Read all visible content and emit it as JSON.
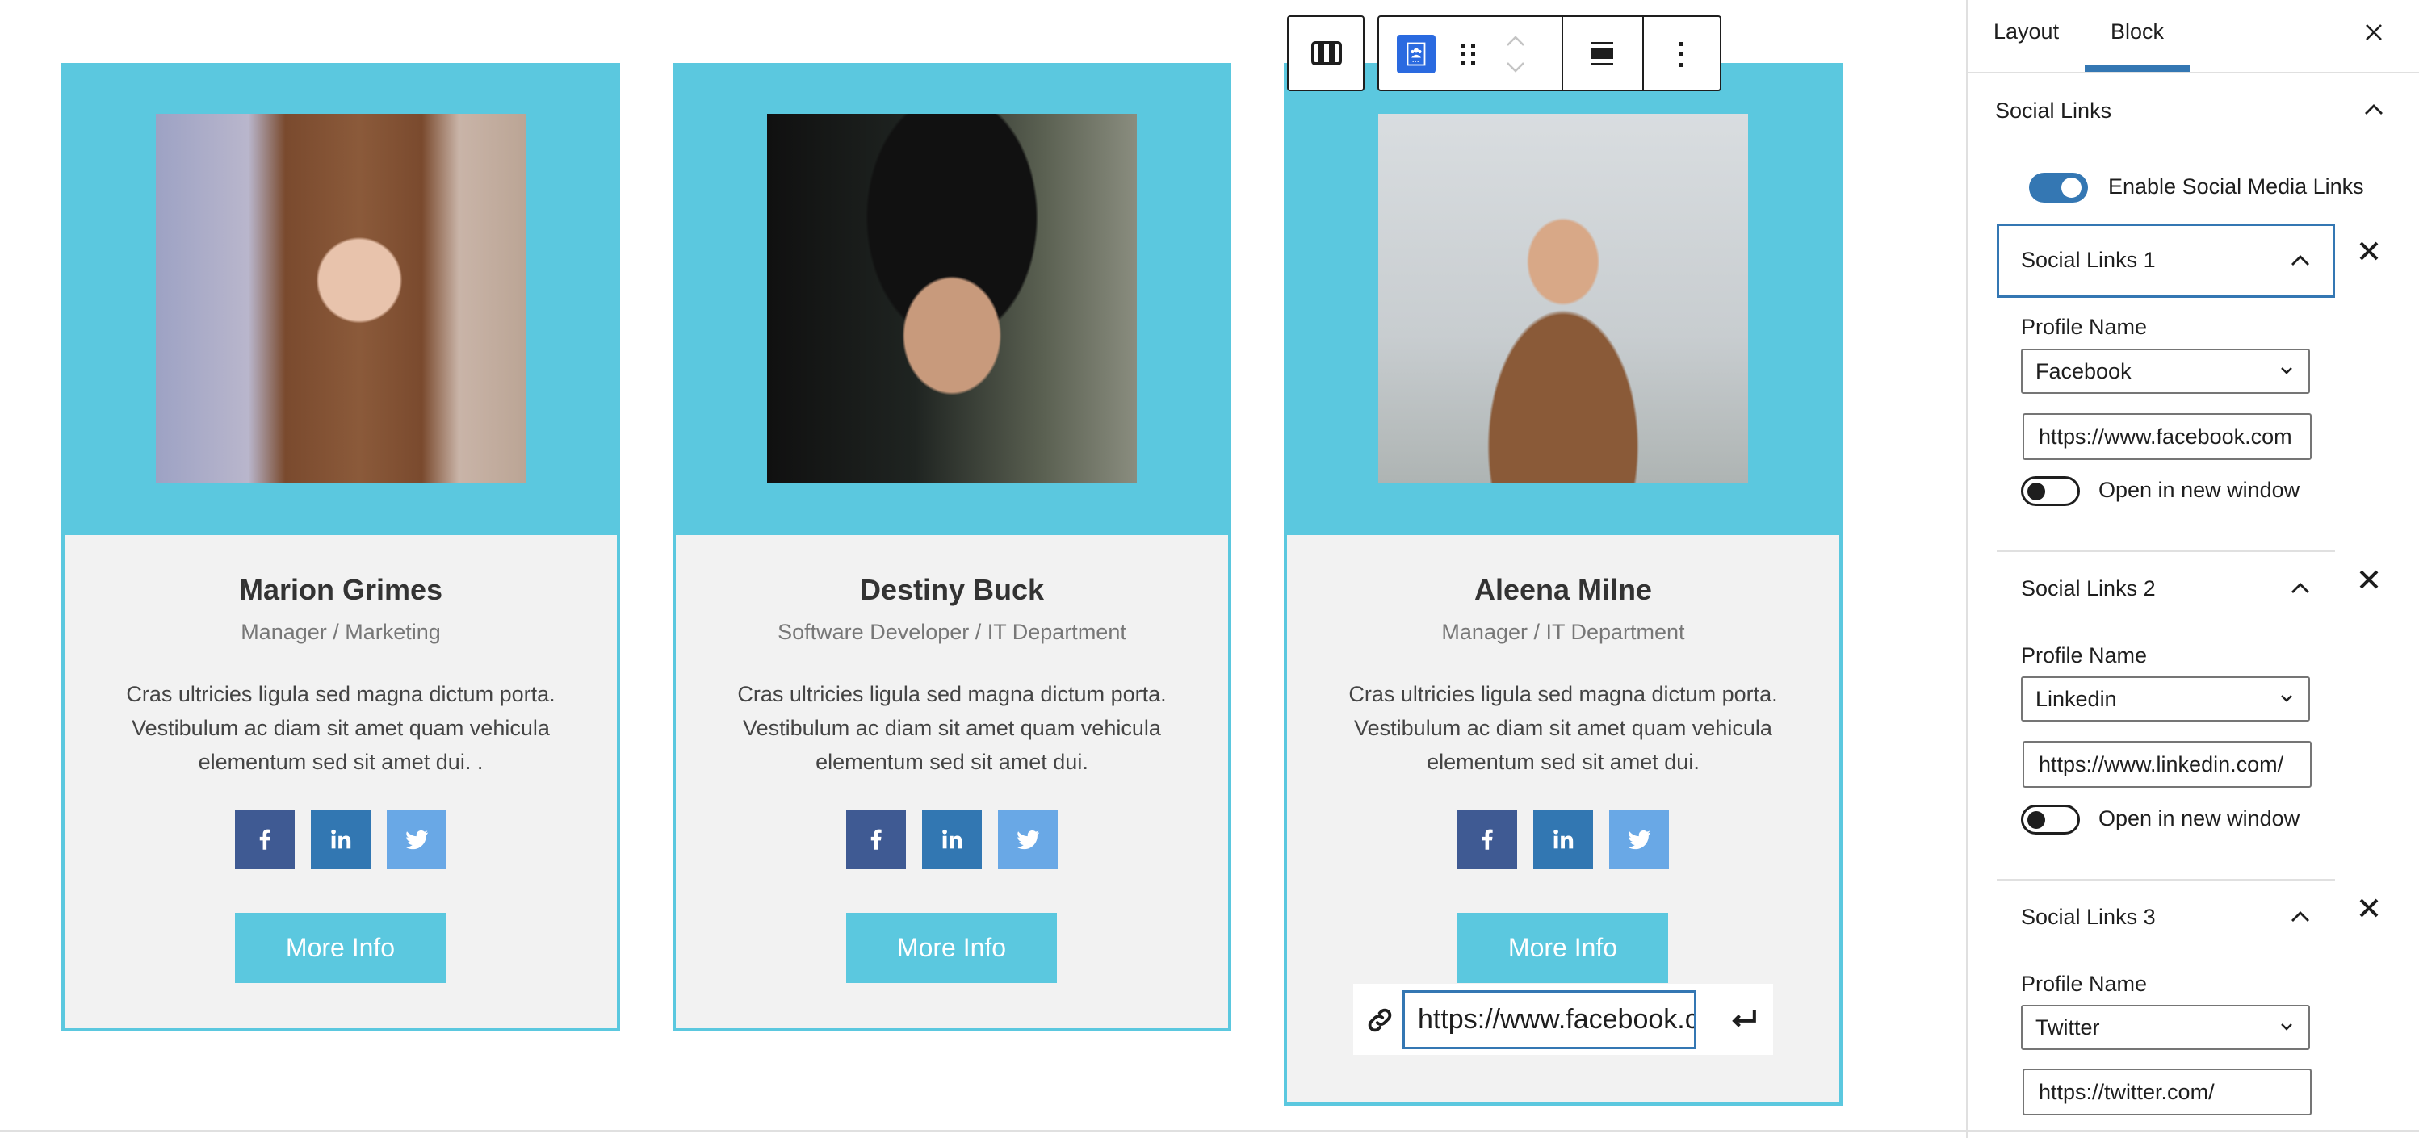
{
  "cards": [
    {
      "name": "Marion Grimes",
      "role": "Manager / Marketing",
      "description": "Cras ultricies ligula sed magna dictum porta. Vestibulum ac diam sit amet quam vehicula elementum sed sit amet dui. .",
      "button_label": "More Info",
      "photo": "portrait-woman-brown-hair"
    },
    {
      "name": "Destiny Buck",
      "role": "Software Developer / IT Department",
      "description": "Cras ultricies ligula sed magna dictum porta. Vestibulum ac diam sit amet quam vehicula elementum sed sit amet dui.",
      "button_label": "More Info",
      "photo": "portrait-man-dark-hair"
    },
    {
      "name": "Aleena Milne",
      "role": "Manager / IT Department",
      "description": "Cras ultricies ligula sed magna dictum porta. Vestibulum ac diam sit amet quam vehicula elementum sed sit amet dui.",
      "button_label": "More Info",
      "photo": "portrait-woman-smiling-palms"
    }
  ],
  "social_icons": [
    {
      "name": "facebook-icon",
      "color": "#3f5a93"
    },
    {
      "name": "linkedin-icon",
      "color": "#3277b2"
    },
    {
      "name": "twitter-icon",
      "color": "#69a8e6"
    }
  ],
  "colors": {
    "accent": "#5bc8df",
    "card_body": "#f2f2f2",
    "wp_blue": "#3477b3",
    "block_icon": "#2a6ae0"
  },
  "link_popover": {
    "url_value": "https://www.facebook.com/"
  },
  "toolbar": {
    "parent_icon": "columns-icon",
    "block_icon": "team-member-icon",
    "drag_icon": "drag-handle-icon",
    "move_up_icon": "chevron-up-icon",
    "move_down_icon": "chevron-down-icon",
    "align_icon": "align-wide-icon",
    "more_icon": "more-vertical-icon"
  },
  "sidebar": {
    "tabs": [
      {
        "label": "Layout",
        "active": false
      },
      {
        "label": "Block",
        "active": true
      }
    ],
    "panel_title": "Social Links",
    "enable_toggle": {
      "label": "Enable Social Media Links",
      "on": true
    },
    "links": [
      {
        "title": "Social Links 1",
        "profile_label": "Profile Name",
        "profile_value": "Facebook",
        "url": "https://www.facebook.com",
        "new_window_label": "Open in new window",
        "new_window": false
      },
      {
        "title": "Social Links 2",
        "profile_label": "Profile Name",
        "profile_value": "Linkedin",
        "url": "https://www.linkedin.com/",
        "new_window_label": "Open in new window",
        "new_window": false
      },
      {
        "title": "Social Links 3",
        "profile_label": "Profile Name",
        "profile_value": "Twitter",
        "url": "https://twitter.com/"
      }
    ]
  }
}
